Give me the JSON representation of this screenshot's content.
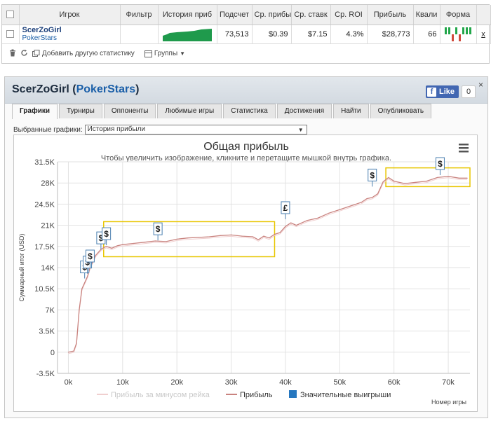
{
  "stats_table": {
    "headers": [
      "Игрок",
      "Фильтр",
      "История приб",
      "Подсчет",
      "Ср. прибы",
      "Ср. ставк",
      "Ср. ROI",
      "Прибыль",
      "Квали",
      "Форма"
    ],
    "row": {
      "player": "ScerZoGirl",
      "site": "PokerStars",
      "filter": "",
      "count": "73,513",
      "avg_profit": "$0.39",
      "avg_stake": "$7.15",
      "avg_roi": "4.3%",
      "profit": "$28,773",
      "ability": "66",
      "remove_link": "x"
    },
    "form": [
      1,
      1,
      -1,
      1,
      -1,
      1,
      1,
      1
    ],
    "footer": {
      "add_stats": "Добавить другую статистику",
      "groups": "Группы"
    }
  },
  "panel": {
    "player": "ScerZoGirl",
    "site": "PokerStars",
    "fb_like": "Like",
    "fb_count": "0",
    "close": "×"
  },
  "tabs": [
    "Графики",
    "Турниры",
    "Оппоненты",
    "Любимые игры",
    "Статистика",
    "Достижения",
    "Найти",
    "Опубликовать"
  ],
  "active_tab": 0,
  "picker": {
    "label": "Выбранные графики:",
    "value": "История прибыли"
  },
  "chart_data": {
    "type": "line",
    "title": "Общая прибыль",
    "subtitle": "Чтобы увеличить изображение, кликните и перетащите мышкой внутрь графика.",
    "ylabel": "Суммарный итог (USD)",
    "xlabel": "Номер игры",
    "ylim": [
      -3500,
      31500
    ],
    "xlim": [
      -2000,
      74000
    ],
    "y_ticks": [
      "-3.5K",
      "0",
      "3.5K",
      "7K",
      "10.5K",
      "14K",
      "17.5K",
      "21K",
      "24.5K",
      "28K",
      "31.5K"
    ],
    "x_ticks": [
      "0k",
      "10k",
      "20k",
      "30k",
      "40k",
      "50k",
      "60k",
      "70k"
    ],
    "grid": true,
    "colors": {
      "profit": "#c9837f",
      "rake": "#f0cfcf",
      "big_wins": "#2677bf",
      "highlight": "#e8c600"
    },
    "legend": {
      "placement": "bottom",
      "items": [
        "Прибыль за минусом рейка",
        "Прибыль",
        "Значительные выигрыши"
      ]
    },
    "series": [
      {
        "name": "Прибыль",
        "x": [
          0,
          1000,
          1500,
          2000,
          2500,
          3000,
          3500,
          4000,
          5000,
          6000,
          6500,
          7000,
          8000,
          9000,
          10000,
          12000,
          14000,
          16000,
          18000,
          20000,
          22000,
          24000,
          26000,
          28000,
          30000,
          32000,
          34000,
          35000,
          36000,
          37000,
          38000,
          39000,
          40000,
          41000,
          42000,
          44000,
          46000,
          48000,
          50000,
          52000,
          54000,
          55000,
          56000,
          57000,
          58000,
          59000,
          60000,
          62000,
          64000,
          66000,
          68000,
          70000,
          72000,
          73500
        ],
        "y": [
          0,
          200,
          1500,
          7000,
          10500,
          11500,
          12500,
          14000,
          16000,
          17000,
          17300,
          17500,
          17200,
          17600,
          17800,
          18000,
          18200,
          18400,
          18300,
          18700,
          18900,
          19000,
          19100,
          19300,
          19400,
          19200,
          19100,
          18600,
          19200,
          18900,
          19500,
          19800,
          20800,
          21400,
          21000,
          21800,
          22200,
          23000,
          23600,
          24200,
          24800,
          25400,
          25600,
          26200,
          28200,
          28900,
          28300,
          27900,
          28100,
          28300,
          28900,
          29100,
          28800,
          28800
        ]
      }
    ],
    "big_wins": [
      {
        "x": 3000,
        "y": 12200,
        "symbol": "$"
      },
      {
        "x": 3500,
        "y": 13000,
        "symbol": "$"
      },
      {
        "x": 4000,
        "y": 14000,
        "symbol": "$"
      },
      {
        "x": 6000,
        "y": 17000,
        "symbol": "$"
      },
      {
        "x": 7000,
        "y": 17700,
        "symbol": "$"
      },
      {
        "x": 16500,
        "y": 18500,
        "symbol": "$"
      },
      {
        "x": 40000,
        "y": 22000,
        "symbol": "£"
      },
      {
        "x": 56000,
        "y": 27400,
        "symbol": "$"
      },
      {
        "x": 68500,
        "y": 29300,
        "symbol": "$"
      }
    ],
    "highlights": [
      {
        "x": [
          6500,
          38000
        ],
        "y": [
          15800,
          21600
        ]
      },
      {
        "x": [
          58500,
          74000
        ],
        "y": [
          27400,
          30500
        ]
      }
    ]
  }
}
